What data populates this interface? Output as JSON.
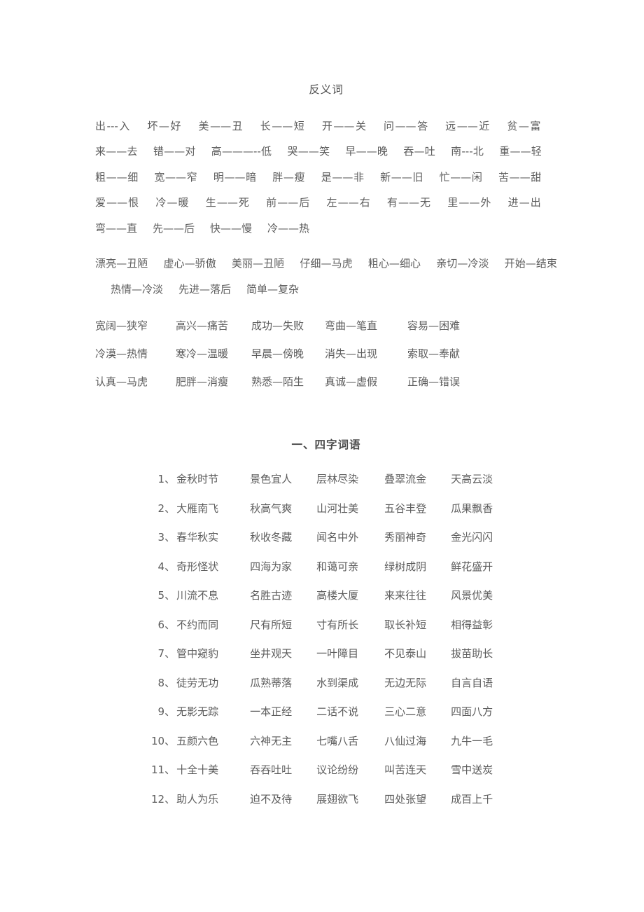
{
  "document": {
    "title": "反义词"
  },
  "antonyms": {
    "title": "反义词",
    "group1_flow": [
      "出---入",
      "坏—好",
      "美——丑",
      "长——短",
      "开——关",
      "问——答",
      "远——近",
      "贫—富",
      "来——去",
      "错——对",
      "高———--低",
      "哭——笑",
      "早——晚",
      "吞—吐",
      "南---北",
      "重——轻",
      "粗——细",
      "宽——窄",
      "明——暗",
      "胖—瘦",
      "是——非",
      "新——旧",
      "忙——闲",
      "苦——甜",
      "爱——恨",
      "冷—暖",
      "生——死",
      "前——后",
      "左——右",
      "有——无",
      "里——外",
      "进—出",
      "弯——直",
      "先——后",
      "快——慢",
      "冷——热"
    ],
    "group2_flow": [
      "漂亮—丑陋",
      "虚心—骄傲",
      "美丽—丑陋",
      "仔细—马虎",
      "粗心—细心",
      "亲切—冷淡",
      "开始—结束",
      "热情—冷淡",
      "先进—落后",
      "简单—复杂"
    ],
    "group3_rows": [
      [
        "宽阔—狭窄",
        "高兴—痛苦",
        "成功—失败",
        "弯曲—笔直",
        "容易—困难"
      ],
      [
        "冷漠—热情",
        "寒冷—温暖",
        "早晨—傍晚",
        "消失—出现",
        "索取—奉献"
      ],
      [
        "认真—马虎",
        "肥胖—消瘦",
        "熟悉—陌生",
        "真诚—虚假",
        "正确—错误"
      ]
    ]
  },
  "four_char": {
    "heading": "一、四字词语",
    "rows": [
      {
        "index": "1、",
        "items": [
          "金秋时节",
          "景色宜人",
          "层林尽染",
          "叠翠流金",
          "天高云淡"
        ]
      },
      {
        "index": "2、",
        "items": [
          "大雁南飞",
          "秋高气爽",
          "山河壮美",
          "五谷丰登",
          "瓜果飘香"
        ]
      },
      {
        "index": "3、",
        "items": [
          "春华秋实",
          "秋收冬藏",
          "闻名中外",
          "秀丽神奇",
          "金光闪闪"
        ]
      },
      {
        "index": "4、",
        "items": [
          "奇形怪状",
          "四海为家",
          "和蔼可亲",
          "绿树成阴",
          "鲜花盛开"
        ]
      },
      {
        "index": "5、",
        "items": [
          "川流不息",
          "名胜古迹",
          "高楼大厦",
          "来来往往",
          "风景优美"
        ]
      },
      {
        "index": "6、",
        "items": [
          "不约而同",
          "尺有所短",
          "寸有所长",
          "取长补短",
          "相得益彰"
        ]
      },
      {
        "index": "7、",
        "items": [
          "管中窥豹",
          "坐井观天",
          "一叶障目",
          "不见泰山",
          "拔苗助长"
        ]
      },
      {
        "index": "8、",
        "items": [
          "徒劳无功",
          "瓜熟蒂落",
          "水到渠成",
          "无边无际",
          "自言自语"
        ]
      },
      {
        "index": "9、",
        "items": [
          "无影无踪",
          "一本正经",
          "二话不说",
          "三心二意",
          "四面八方"
        ]
      },
      {
        "index": "10、",
        "items": [
          "五颜六色",
          "六神无主",
          "七嘴八舌",
          "八仙过海",
          "九牛一毛"
        ]
      },
      {
        "index": "11、",
        "items": [
          "十全十美",
          "吞吞吐吐",
          "议论纷纷",
          "叫苦连天",
          "雪中送炭"
        ]
      },
      {
        "index": "12、",
        "items": [
          "助人为乐",
          "迫不及待",
          "展翅欲飞",
          "四处张望",
          "成百上千"
        ]
      }
    ]
  },
  "style": {
    "text_color": "#5c5c5c",
    "heading_color": "#4a4a4a",
    "background": "#ffffff"
  }
}
